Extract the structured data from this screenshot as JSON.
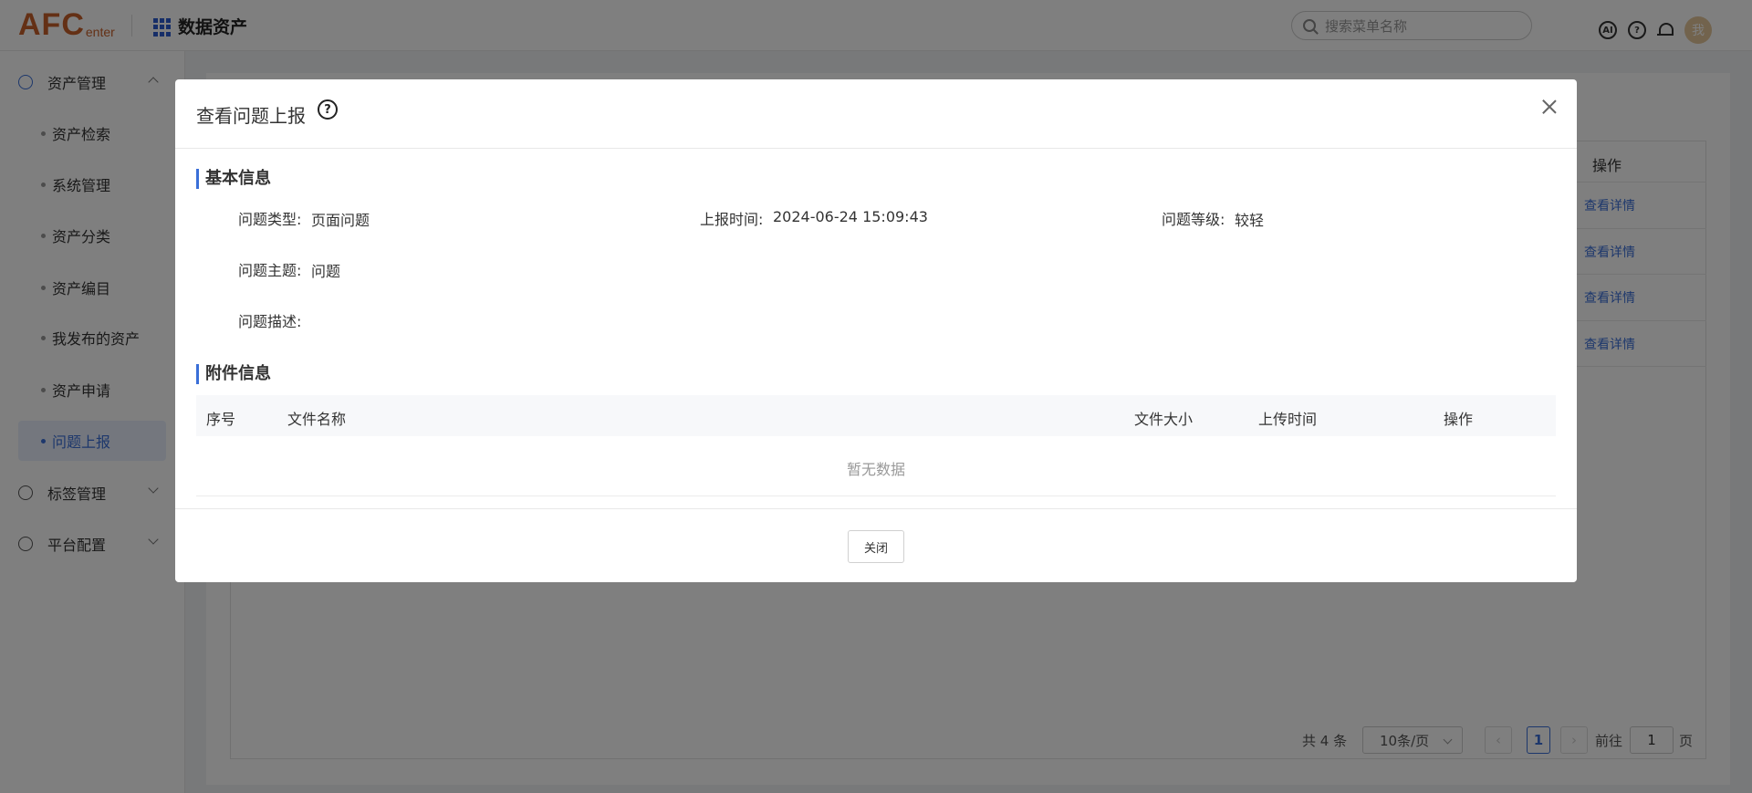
{
  "header": {
    "logo_big": "AFC",
    "logo_small": "enter",
    "app_title": "数据资产",
    "search_placeholder": "搜索菜单名称",
    "ai_icon": "AI",
    "help_icon": "?",
    "avatar_text": "我"
  },
  "sidebar": {
    "groups": [
      {
        "label": "资产管理",
        "icon": "clock-icon",
        "expanded": true
      },
      {
        "label": "标签管理",
        "icon": "plus-circle-icon",
        "expanded": false
      },
      {
        "label": "平台配置",
        "icon": "target-icon",
        "expanded": false
      }
    ],
    "items": [
      {
        "label": "资产检索"
      },
      {
        "label": "系统管理"
      },
      {
        "label": "资产分类"
      },
      {
        "label": "资产编目"
      },
      {
        "label": "我发布的资产"
      },
      {
        "label": "资产申请"
      },
      {
        "label": "问题上报",
        "active": true
      }
    ]
  },
  "background_table": {
    "action_header": "操作",
    "rows": [
      {
        "action": "查看详情"
      },
      {
        "action": "查看详情"
      },
      {
        "action": "查看详情"
      },
      {
        "action": "查看详情"
      }
    ],
    "pagination": {
      "total": "共 4 条",
      "page_size": "10条/页",
      "prev": "‹",
      "current": "1",
      "next": "›",
      "goto_label": "前往",
      "goto_value": "1",
      "unit": "页"
    }
  },
  "modal": {
    "title": "查看问题上报",
    "help_icon": "?",
    "basic_section": "基本信息",
    "fields": {
      "type_label": "问题类型:",
      "type_value": "页面问题",
      "time_label": "上报时间:",
      "time_value": "2024-06-24 15:09:43",
      "level_label": "问题等级:",
      "level_value": "较轻",
      "subject_label": "问题主题:",
      "subject_value": "问题",
      "desc_label": "问题描述:",
      "desc_value": ""
    },
    "attachment_section": "附件信息",
    "columns": [
      "序号",
      "文件名称",
      "文件大小",
      "上传时间",
      "操作"
    ],
    "empty_text": "暂无数据",
    "close_button": "关闭"
  },
  "colors": {
    "accent": "#3a6fd8",
    "logo": "#c8602a",
    "overlay": "rgba(0,0,0,0.5)"
  }
}
